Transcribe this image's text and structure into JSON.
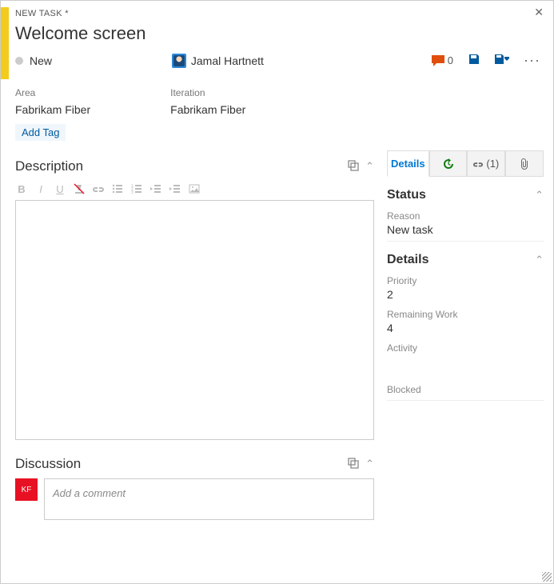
{
  "header": {
    "type_label": "NEW TASK *",
    "title": "Welcome screen",
    "state": "New",
    "assignee": "Jamal Hartnett",
    "comment_count": "0"
  },
  "fields": {
    "area_label": "Area",
    "area_value": "Fabrikam Fiber",
    "iteration_label": "Iteration",
    "iteration_value": "Fabrikam Fiber",
    "add_tag_label": "Add Tag"
  },
  "left": {
    "description_heading": "Description",
    "discussion_heading": "Discussion",
    "discussion_placeholder": "Add a comment",
    "discussion_avatar_initials": "KF"
  },
  "tabs": {
    "details": "Details",
    "links_count": "(1)"
  },
  "status_section": {
    "heading": "Status",
    "reason_label": "Reason",
    "reason_value": "New task"
  },
  "details_section": {
    "heading": "Details",
    "priority_label": "Priority",
    "priority_value": "2",
    "remaining_label": "Remaining Work",
    "remaining_value": "4",
    "activity_label": "Activity",
    "blocked_label": "Blocked"
  }
}
